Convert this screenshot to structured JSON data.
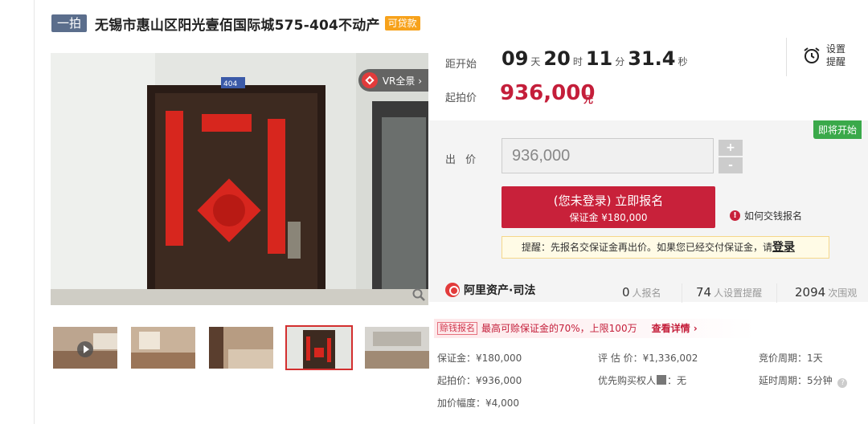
{
  "title": {
    "round_badge": "一拍",
    "text": "无锡市惠山区阳光壹佰国际城575-404不动产",
    "loan_badge": "可贷款"
  },
  "gallery": {
    "vr_label": "VR全景 ›",
    "door_number": "404",
    "thumbnails": [
      "room-video",
      "room-1",
      "bedroom",
      "door",
      "kitchen"
    ],
    "active_thumbnail": 3
  },
  "countdown": {
    "label": "距开始",
    "days": "09",
    "days_unit": "天",
    "hours": "20",
    "hours_unit": "时",
    "minutes": "11",
    "minutes_unit": "分",
    "seconds": "31.4",
    "seconds_unit": "秒",
    "alarm_line1": "设置",
    "alarm_line2": "提醒"
  },
  "start_price": {
    "label": "起拍价",
    "value": "936,000",
    "unit": "元"
  },
  "bid": {
    "status_badge": "即将开始",
    "label": "出 价",
    "input_value": "936,000",
    "plus": "+",
    "minus": "-",
    "signup_line1": "(您未登录) 立即报名",
    "signup_line2": "保证金 ¥180,000",
    "how_pay": "如何交钱报名",
    "tip_text": "提醒：先报名交保证金再出价。如果您已经交付保证金，请",
    "tip_login": "登录"
  },
  "brand": {
    "name": "阿里资产·司法"
  },
  "stats": {
    "signup_count": "0",
    "signup_label": "人报名",
    "reminder_count": "74",
    "reminder_label": "人设置提醒",
    "view_count": "2094",
    "view_label": "次围观"
  },
  "promo": {
    "tag": "赊钱报名",
    "text": "最高可赊保证金的70%，上限100万",
    "link": "查看详情 ›"
  },
  "details": {
    "deposit": "保证金：¥180,000",
    "appraisal": "评 估 价：¥1,336,002",
    "auction_cycle": "竞价周期：1天",
    "start_price": "起拍价：¥936,000",
    "priority_buyer": "优先购买权人",
    "priority_value": "：无",
    "delay_cycle": "延时周期：5分钟",
    "increment": "加价幅度：¥4,000"
  },
  "colors": {
    "accent_red": "#c8213a",
    "badge_orange": "#f7a21b",
    "badge_green": "#3aa94a",
    "round_badge": "#5b6e8c"
  }
}
